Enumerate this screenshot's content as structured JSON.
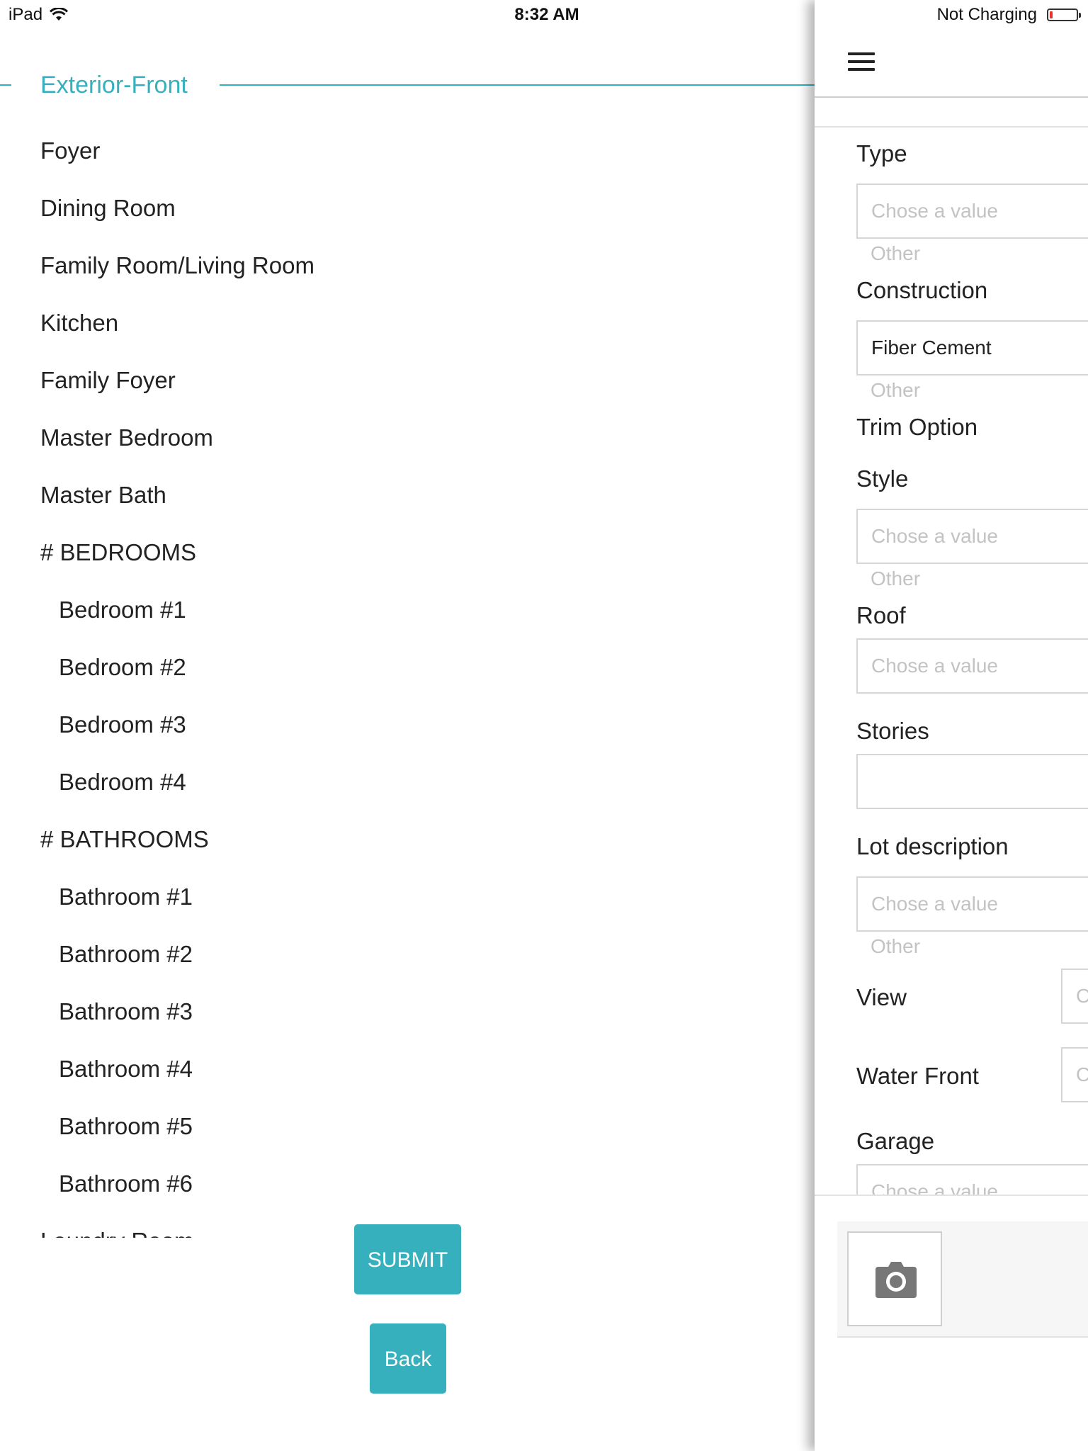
{
  "status_bar": {
    "device": "iPad",
    "time": "8:32 AM",
    "battery_status": "Not Charging",
    "icons": [
      "wifi-icon",
      "battery-icon"
    ]
  },
  "section": {
    "title": "Exterior-Front",
    "accent_color": "#36b0bd"
  },
  "rooms": [
    {
      "label": "Foyer",
      "sub": false
    },
    {
      "label": "Dining Room",
      "sub": false
    },
    {
      "label": "Family Room/Living Room",
      "sub": false
    },
    {
      "label": "Kitchen",
      "sub": false
    },
    {
      "label": "Family Foyer",
      "sub": false
    },
    {
      "label": "Master Bedroom",
      "sub": false
    },
    {
      "label": "Master Bath",
      "sub": false
    },
    {
      "label": "# BEDROOMS",
      "sub": false
    },
    {
      "label": "Bedroom #1",
      "sub": true
    },
    {
      "label": "Bedroom #2",
      "sub": true
    },
    {
      "label": "Bedroom #3",
      "sub": true
    },
    {
      "label": "Bedroom #4",
      "sub": true
    },
    {
      "label": "# BATHROOMS",
      "sub": false
    },
    {
      "label": "Bathroom #1",
      "sub": true
    },
    {
      "label": "Bathroom #2",
      "sub": true
    },
    {
      "label": "Bathroom #3",
      "sub": true
    },
    {
      "label": "Bathroom #4",
      "sub": true
    },
    {
      "label": "Bathroom #5",
      "sub": true
    },
    {
      "label": "Bathroom #6",
      "sub": true
    },
    {
      "label": "Laundry Room",
      "sub": false
    }
  ],
  "buttons": {
    "submit": "SUBMIT",
    "back": "Back"
  },
  "drawer": {
    "menu_icon": "hamburger-icon",
    "fields": {
      "type": {
        "label": "Type",
        "placeholder": "Chose a value",
        "other": "Other"
      },
      "construction": {
        "label": "Construction",
        "value": "Fiber Cement",
        "other": "Other"
      },
      "trim_option": {
        "label": "Trim Option"
      },
      "style": {
        "label": "Style",
        "placeholder": "Chose a value",
        "other": "Other"
      },
      "roof": {
        "label": "Roof",
        "placeholder": "Chose a value"
      },
      "stories": {
        "label": "Stories",
        "value": ""
      },
      "lot_description": {
        "label": "Lot description",
        "placeholder": "Chose a value",
        "other": "Other"
      },
      "view": {
        "label": "View",
        "placeholder": "C"
      },
      "water_front": {
        "label": "Water Front",
        "placeholder": "C"
      },
      "garage": {
        "label": "Garage",
        "placeholder": "Chose a value"
      }
    },
    "photo_icon": "camera-icon"
  }
}
